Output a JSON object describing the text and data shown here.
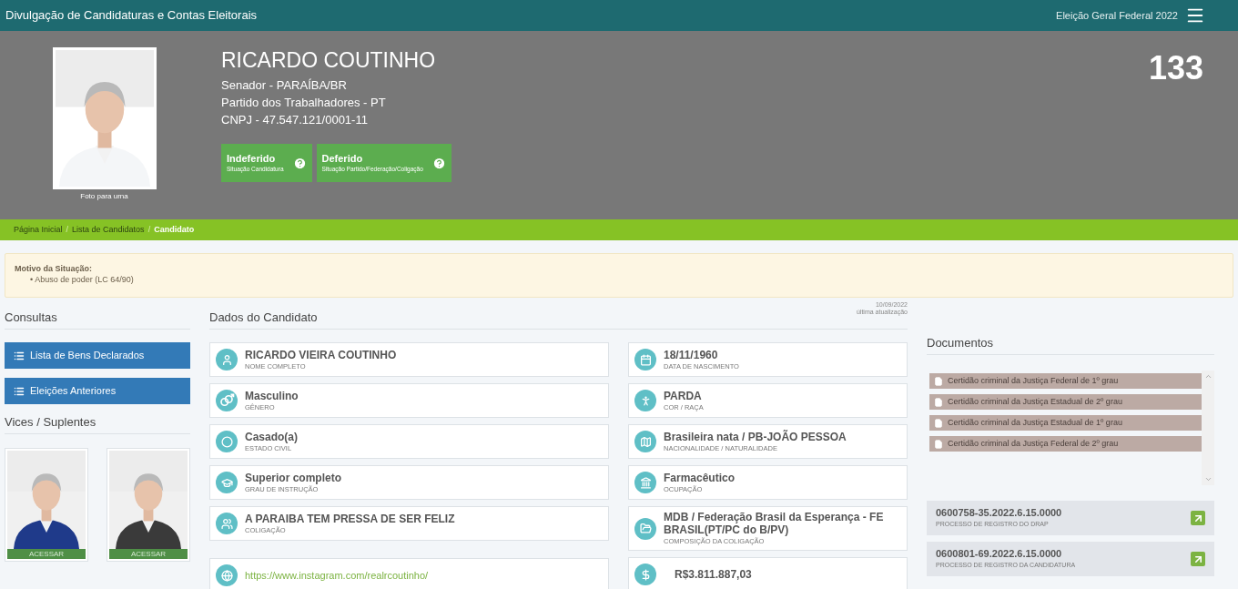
{
  "top_bar": {
    "title": "Divulgação de Candidaturas e Contas Eleitorais",
    "election": "Eleição Geral Federal 2022"
  },
  "candidate": {
    "name": "RICARDO COUTINHO",
    "lines": [
      "Senador - PARAÍBA/BR",
      "Partido dos Trabalhadores - PT",
      "CNPJ - 47.547.121/0001-11"
    ],
    "number": "133",
    "photo_caption": "Foto para urna",
    "statuses": [
      {
        "value": "Indeferido",
        "label": "Situação Candidatura"
      },
      {
        "value": "Deferido",
        "label": "Situação Partido/Federação/Coligação"
      }
    ]
  },
  "breadcrumb_separator": "/",
  "breadcrumb": [
    {
      "label": "Página Inicial",
      "selected": false
    },
    {
      "label": "Lista de Candidatos",
      "selected": false
    },
    {
      "label": "Candidato",
      "selected": true
    }
  ],
  "alert": {
    "title": "Motivo da Situação:",
    "bullet": "•",
    "items": [
      "Abuso de poder (LC 64/90)"
    ]
  },
  "consultas": {
    "title": "Consultas",
    "buttons": [
      "Lista de Bens Declarados",
      "Eleições Anteriores"
    ]
  },
  "vices": {
    "title": "Vices / Suplentes",
    "cards": [
      {
        "kind": "picture",
        "action": "ACESSAR"
      },
      {
        "kind": "picture",
        "action": "ACESSAR"
      }
    ]
  },
  "dados": {
    "title": "Dados do Candidato",
    "updated_date": "10/09/2022",
    "updated_label": "última atualização",
    "left": [
      {
        "kind": "field",
        "value": "RICARDO VIEIRA COUTINHO",
        "label": "NOME COMPLETO"
      },
      {
        "kind": "field",
        "value": "Masculino",
        "label": "GÊNERO"
      },
      {
        "kind": "field",
        "value": "Casado(a)",
        "label": "ESTADO CIVIL"
      },
      {
        "kind": "field",
        "value": "Superior completo",
        "label": "GRAU DE INSTRUÇÃO"
      },
      {
        "kind": "field",
        "value": "A PARAIBA TEM PRESSA DE SER FELIZ",
        "label": "COLIGAÇÃO"
      },
      {
        "kind": "link",
        "value": "https://www.instagram.com/realrcoutinho/"
      }
    ],
    "right": [
      {
        "kind": "field",
        "value": "18/11/1960",
        "label": "DATA DE NASCIMENTO"
      },
      {
        "kind": "field",
        "value": "PARDA",
        "label": "COR / RAÇA"
      },
      {
        "kind": "field",
        "value": "Brasileira nata / PB-JOÃO PESSOA",
        "label": "NACIONALIDADE / NATURALIDADE"
      },
      {
        "kind": "field",
        "value": "Farmacêutico",
        "label": "OCUPAÇÃO"
      },
      {
        "kind": "field",
        "value": "MDB / Federação Brasil da Esperança - FE BRASIL(PT/PC do B/PV)",
        "label": "COMPOSIÇÃO DA COLIGAÇÃO"
      },
      {
        "kind": "money",
        "value": "R$3.811.887,03"
      }
    ]
  },
  "documentos": {
    "title": "Documentos",
    "files": [
      "Certidão criminal da Justiça Federal de 1º grau",
      "Certidão criminal da Justiça Estadual de 2º grau",
      "Certidão criminal da Justiça Estadual de 1º grau",
      "Certidão criminal da Justiça Federal de 2º grau"
    ],
    "processes": [
      {
        "number": "0600758-35.2022.6.15.0000",
        "label": "PROCESSO DE REGISTRO DO DRAP"
      },
      {
        "number": "0600801-69.2022.6.15.0000",
        "label": "PROCESSO DE REGISTRO DA CANDIDATURA"
      }
    ]
  }
}
